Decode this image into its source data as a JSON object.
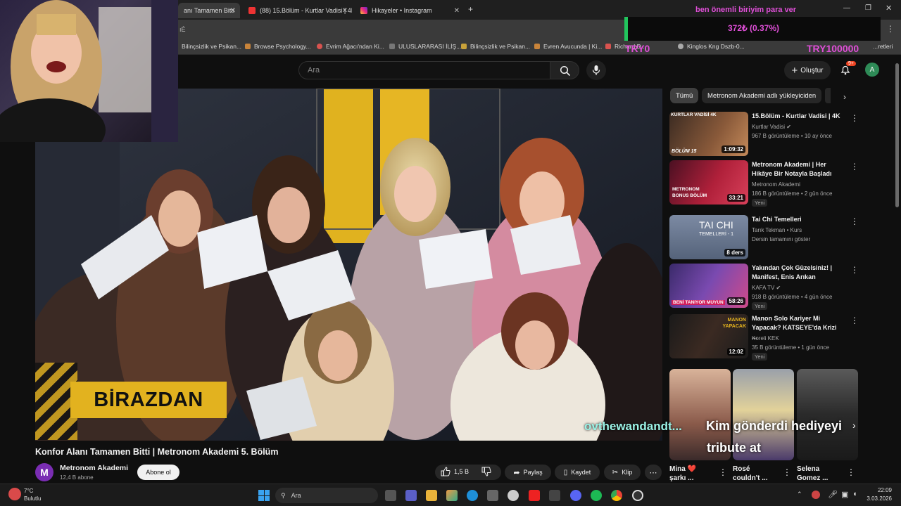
{
  "browser": {
    "tabs": [
      {
        "label": "anı Tamamen Bitti",
        "active": true
      },
      {
        "label": "(88) 15.Bölüm - Kurtlar Vadisi | 4K",
        "active": false
      },
      {
        "label": "Hikayeler • Instagram",
        "active": false
      }
    ],
    "address_fragment": "ıĖ",
    "bookmarks": [
      "Bilinçsizlik ve Psikan...",
      "Browse Psychology...",
      "Evrim Ağacı'ndan Ki...",
      "ULUSLARARASI İLİŞ...",
      "Bilinçsizlik ve Psikan...",
      "Evren Avucunda | Ki...",
      "Richard D...",
      "Kinglos Kng Dszb-0...",
      "...retleri"
    ]
  },
  "stream_overlay": {
    "goal_text": "ben önemli biriyim para ver",
    "goal_amount": "372₺ (0.37%)",
    "left_label": "TRY0",
    "right_label": "TRY100000",
    "alert_user": "ovthewandandt...",
    "alert_text_line1": "Kim gönderdi hediyeyi",
    "alert_text_line2": "tribute at"
  },
  "youtube": {
    "search_placeholder": "Ara",
    "create_label": "Oluştur",
    "notif_count": "9+",
    "avatar_letter": "A",
    "video": {
      "overlay_text": "BİRAZDAN",
      "title": "Konfor Alanı Tamamen Bitti | Metronom Akademi 5. Bölüm",
      "channel": "Metronom Akademi",
      "subscribers": "12,4 B abone",
      "subscribe_label": "Abone ol",
      "likes": "1,5 B",
      "share_label": "Paylaş",
      "save_label": "Kaydet",
      "clip_label": "Klip"
    },
    "chips": [
      "Tümü",
      "Metronom Akademi adlı yükleyiciden"
    ],
    "recommendations": [
      {
        "title": "15.Bölüm - Kurtlar Vadisi | 4K",
        "channel": "Kurtlar Vadisi",
        "meta": "967 B görüntüleme • 10 ay önce",
        "duration": "1:09:32",
        "new": "",
        "thumb_text": "KURTLAR VADİSİ 4K",
        "thumb_text2": "BÖLÜM 15"
      },
      {
        "title": "Metronom Akademi | Her Hikâye Bir Notayla Başladı",
        "channel": "Metronom Akademi",
        "meta": "186 B görüntüleme • 2 gün önce",
        "duration": "33:21",
        "new": "Yeni",
        "thumb_text": "METRONOM BONUS BÖLÜM",
        "thumb_text2": ""
      },
      {
        "title": "Tai Chi Temelleri",
        "channel": "Tarık Tekman • Kurs",
        "meta": "Dersin tamamını göster",
        "duration": "8 ders",
        "new": "",
        "thumb_text": "TAI CHI",
        "thumb_text2": "TEMELLERİ - 1"
      },
      {
        "title": "Yakından Çok Güzelsiniz! | Manifest, Enis Arıkan",
        "channel": "KAFA TV",
        "meta": "918 B görüntüleme • 4 gün önce",
        "duration": "58:26",
        "new": "Yeni",
        "thumb_text": "BENİ TANIYOR MUYUN",
        "thumb_text2": ""
      },
      {
        "title": "Manon Solo Kariyer Mi Yapacak? KATSEYE'da Krizi ...",
        "channel": "Koreli KEK",
        "meta": "35 B görüntüleme • 1 gün önce",
        "duration": "12:02",
        "new": "Yeni",
        "thumb_text": "MANON YAPACAK",
        "thumb_text2": ""
      }
    ],
    "shorts": [
      {
        "title": "Mina ❤️ şarkı ..."
      },
      {
        "title": "Rosé couldn't ..."
      },
      {
        "title": "Selena Gomez ..."
      }
    ]
  },
  "taskbar": {
    "weather_temp": "7°C",
    "weather_desc": "Bulutlu",
    "search_label": "Ara",
    "time": "22:09",
    "date": "3.03.2026"
  }
}
